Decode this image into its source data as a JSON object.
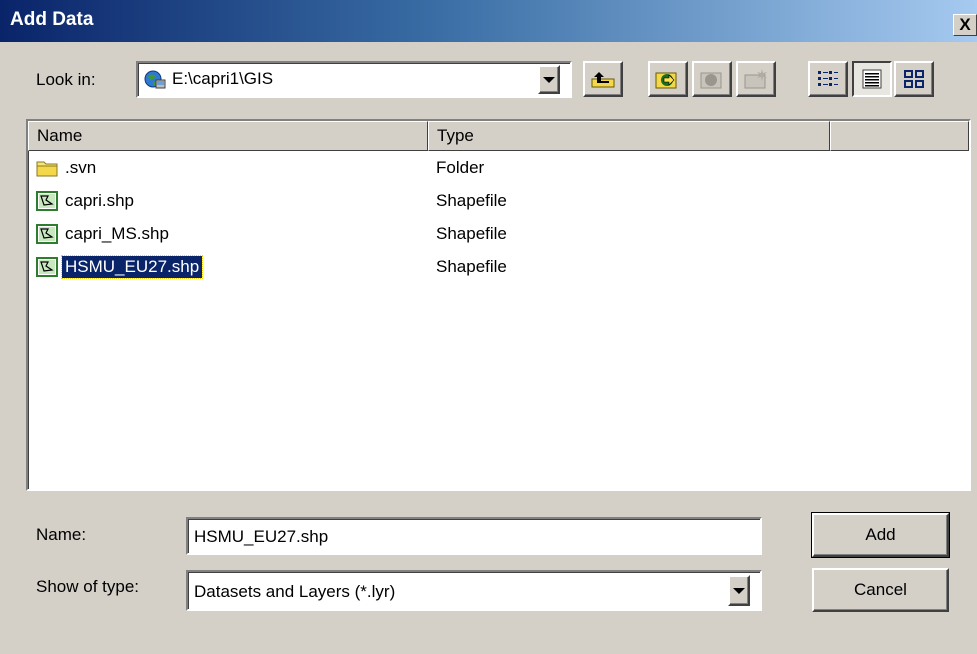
{
  "window": {
    "title": "Add Data",
    "close_label": "X"
  },
  "look_in": {
    "label": "Look in:",
    "value": "E:\\capri1\\GIS"
  },
  "toolbar": {
    "buttons": [
      "up-one-level-icon",
      "connect-folder-icon",
      "disconnect-folder-icon",
      "new-folder-icon",
      "list-view-icon",
      "details-view-icon",
      "thumbnails-view-icon"
    ],
    "active_view": "details-view-icon"
  },
  "list": {
    "columns": [
      "Name",
      "Type",
      ""
    ],
    "rows": [
      {
        "name": ".svn",
        "type": "Folder",
        "icon": "folder-icon",
        "selected": false
      },
      {
        "name": "capri.shp",
        "type": "Shapefile",
        "icon": "shapefile-icon",
        "selected": false
      },
      {
        "name": "capri_MS.shp",
        "type": "Shapefile",
        "icon": "shapefile-icon",
        "selected": false
      },
      {
        "name": "HSMU_EU27.shp",
        "type": "Shapefile",
        "icon": "shapefile-icon",
        "selected": true
      }
    ]
  },
  "name_field": {
    "label": "Name:",
    "value": "HSMU_EU27.shp"
  },
  "type_field": {
    "label": "Show of type:",
    "value": "Datasets and Layers (*.lyr)"
  },
  "buttons": {
    "add": "Add",
    "cancel": "Cancel"
  },
  "colors": {
    "title_start": "#0a246a",
    "title_end": "#a6caf0",
    "selection": "#0a246a",
    "face": "#d4d0c8"
  }
}
